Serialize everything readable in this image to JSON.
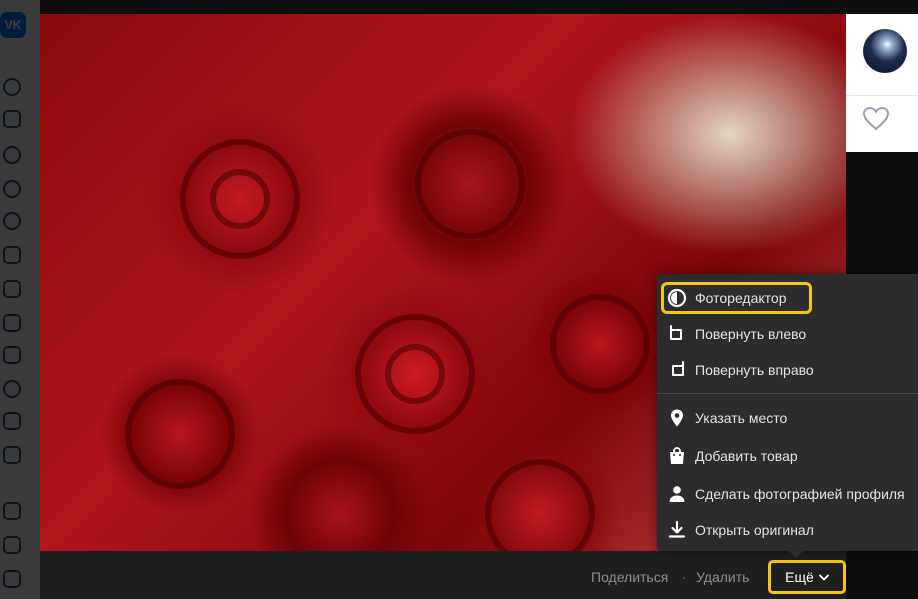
{
  "app": {
    "logo_text": "VK"
  },
  "sidebar": {
    "icons": [
      "profile-icon",
      "news-icon",
      "messenger-icon",
      "friends-icon",
      "communities-icon",
      "photos-icon",
      "music-icon",
      "video-icon",
      "games-icon",
      "stickers-icon",
      "market-icon",
      "services-icon",
      "bookmarks-icon",
      "files-icon",
      "ads-icon"
    ]
  },
  "viewer": {
    "actions": {
      "share_label": "Поделиться",
      "separator": "·",
      "delete_label": "Удалить",
      "more_label": "Ещё"
    }
  },
  "menu": {
    "items": [
      {
        "label": "Фоторедактор",
        "icon": "photo-editor-icon"
      },
      {
        "label": "Повернуть влево",
        "icon": "rotate-left-icon"
      },
      {
        "label": "Повернуть вправо",
        "icon": "rotate-right-icon"
      },
      {
        "label": "Указать место",
        "icon": "location-pin-icon"
      },
      {
        "label": "Добавить товар",
        "icon": "shopping-bag-icon"
      },
      {
        "label": "Сделать фотографией профиля",
        "icon": "person-icon"
      },
      {
        "label": "Открыть оригинал",
        "icon": "download-icon"
      }
    ]
  },
  "colors": {
    "highlight": "#f5c518",
    "menu_background": "#2c2c2c",
    "vk_blue": "#0077ff"
  }
}
